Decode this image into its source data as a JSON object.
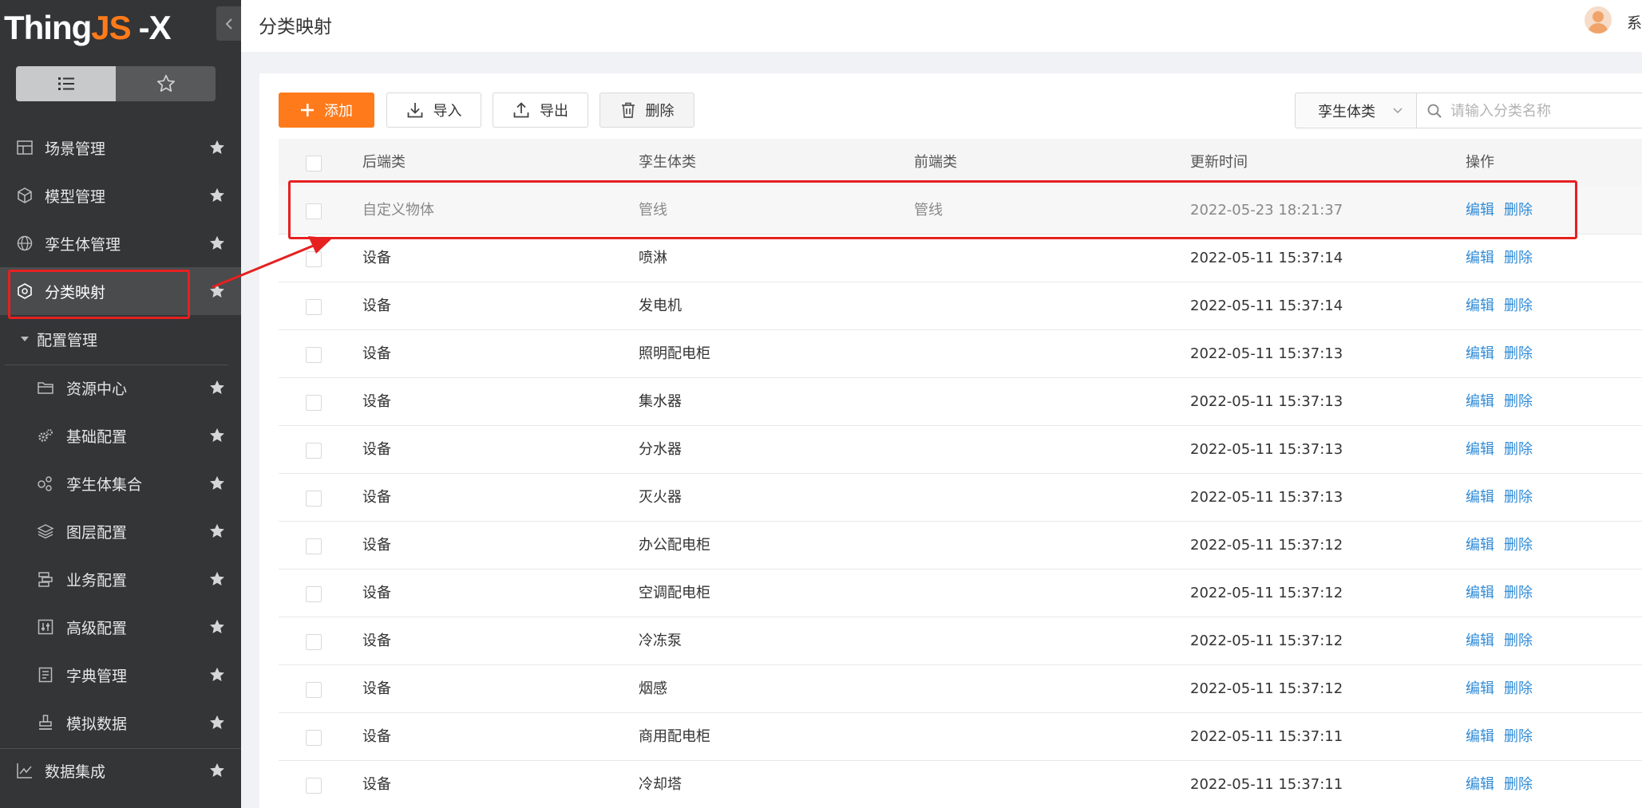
{
  "app": {
    "logo_main": "Thing",
    "logo_accent": "JS",
    "logo_suffix": "-X"
  },
  "sidebar": {
    "view_toggle": [
      {
        "label": "list",
        "icon": "list-icon",
        "active": true
      },
      {
        "label": "favorites",
        "icon": "star-outline-icon",
        "active": false
      }
    ],
    "items": [
      {
        "label": "场景管理",
        "icon": "scene-grid-icon"
      },
      {
        "label": "模型管理",
        "icon": "cube-icon"
      },
      {
        "label": "孪生体管理",
        "icon": "globe-icon"
      },
      {
        "label": "分类映射",
        "icon": "category-map-icon",
        "active": true
      },
      {
        "label": "配置管理",
        "icon": "caret-down-icon",
        "group": true
      },
      {
        "label": "资源中心",
        "icon": "folder-icon"
      },
      {
        "label": "基础配置",
        "icon": "gears-icon"
      },
      {
        "label": "孪生体集合",
        "icon": "collection-icon"
      },
      {
        "label": "图层配置",
        "icon": "layers-icon"
      },
      {
        "label": "业务配置",
        "icon": "business-icon"
      },
      {
        "label": "高级配置",
        "icon": "sliders-icon"
      },
      {
        "label": "字典管理",
        "icon": "dictionary-icon"
      },
      {
        "label": "模拟数据",
        "icon": "stamp-icon"
      },
      {
        "label": "数据集成",
        "icon": "chart-line-icon"
      }
    ]
  },
  "header": {
    "title": "分类映射",
    "user_name": "系统"
  },
  "toolbar": {
    "add_label": "添加",
    "import_label": "导入",
    "export_label": "导出",
    "delete_label": "删除",
    "select_value": "孪生体类",
    "search_placeholder": "请输入分类名称"
  },
  "table": {
    "columns": [
      "后端类",
      "孪生体类",
      "前端类",
      "更新时间",
      "操作"
    ],
    "actions": {
      "edit": "编辑",
      "delete": "删除"
    },
    "rows": [
      {
        "backend": "自定义物体",
        "twin": "管线",
        "frontend": "管线",
        "time": "2022-05-23 18:21:37"
      },
      {
        "backend": "设备",
        "twin": "喷淋",
        "frontend": "",
        "time": "2022-05-11 15:37:14"
      },
      {
        "backend": "设备",
        "twin": "发电机",
        "frontend": "",
        "time": "2022-05-11 15:37:14"
      },
      {
        "backend": "设备",
        "twin": "照明配电柜",
        "frontend": "",
        "time": "2022-05-11 15:37:13"
      },
      {
        "backend": "设备",
        "twin": "集水器",
        "frontend": "",
        "time": "2022-05-11 15:37:13"
      },
      {
        "backend": "设备",
        "twin": "分水器",
        "frontend": "",
        "time": "2022-05-11 15:37:13"
      },
      {
        "backend": "设备",
        "twin": "灭火器",
        "frontend": "",
        "time": "2022-05-11 15:37:13"
      },
      {
        "backend": "设备",
        "twin": "办公配电柜",
        "frontend": "",
        "time": "2022-05-11 15:37:12"
      },
      {
        "backend": "设备",
        "twin": "空调配电柜",
        "frontend": "",
        "time": "2022-05-11 15:37:12"
      },
      {
        "backend": "设备",
        "twin": "冷冻泵",
        "frontend": "",
        "time": "2022-05-11 15:37:12"
      },
      {
        "backend": "设备",
        "twin": "烟感",
        "frontend": "",
        "time": "2022-05-11 15:37:12"
      },
      {
        "backend": "设备",
        "twin": "商用配电柜",
        "frontend": "",
        "time": "2022-05-11 15:37:11"
      },
      {
        "backend": "设备",
        "twin": "冷却塔",
        "frontend": "",
        "time": "2022-05-11 15:37:11"
      }
    ]
  },
  "colors": {
    "accent": "#ff7a1a",
    "link": "#2f8bd7",
    "annotation": "#e62020",
    "sidebar_bg": "#333537"
  }
}
